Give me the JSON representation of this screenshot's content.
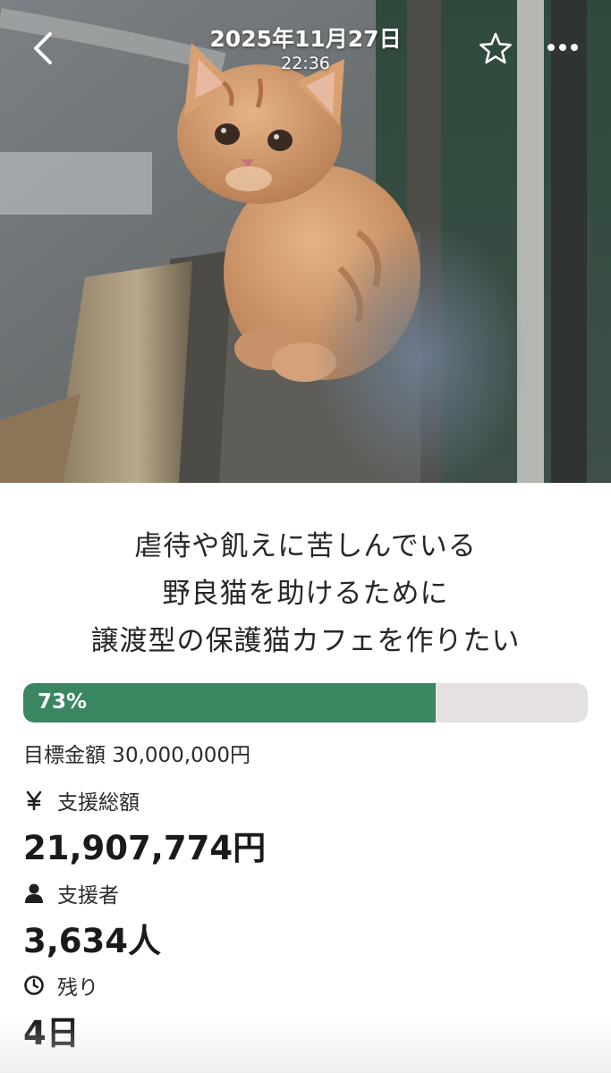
{
  "viewer": {
    "date": "2025年11月27日",
    "time": "22:36",
    "icons": {
      "back": "chevron-left-icon",
      "favorite": "star-outline-icon",
      "more": "more-horizontal-icon"
    }
  },
  "project": {
    "headline_lines": [
      "虐待や飢えに苦しんでいる",
      "野良猫を助けるために",
      "譲渡型の保護猫カフェを作りたい"
    ],
    "progress": {
      "percent": 73,
      "label": "73%"
    },
    "goal": "目標金額 30,000,000円",
    "stats": {
      "total_label": "支援総額",
      "total_value": "21,907,774円",
      "backers_label": "支援者",
      "backers_value": "3,634人",
      "remaining_label": "残り",
      "remaining_value": "4日"
    },
    "stat_icons": {
      "total": "yen-icon",
      "backers": "person-icon",
      "remaining": "clock-icon"
    }
  },
  "colors": {
    "progress_fill": "#3a8660",
    "progress_track": "#e6e1e1",
    "text": "#1a1a1a"
  }
}
